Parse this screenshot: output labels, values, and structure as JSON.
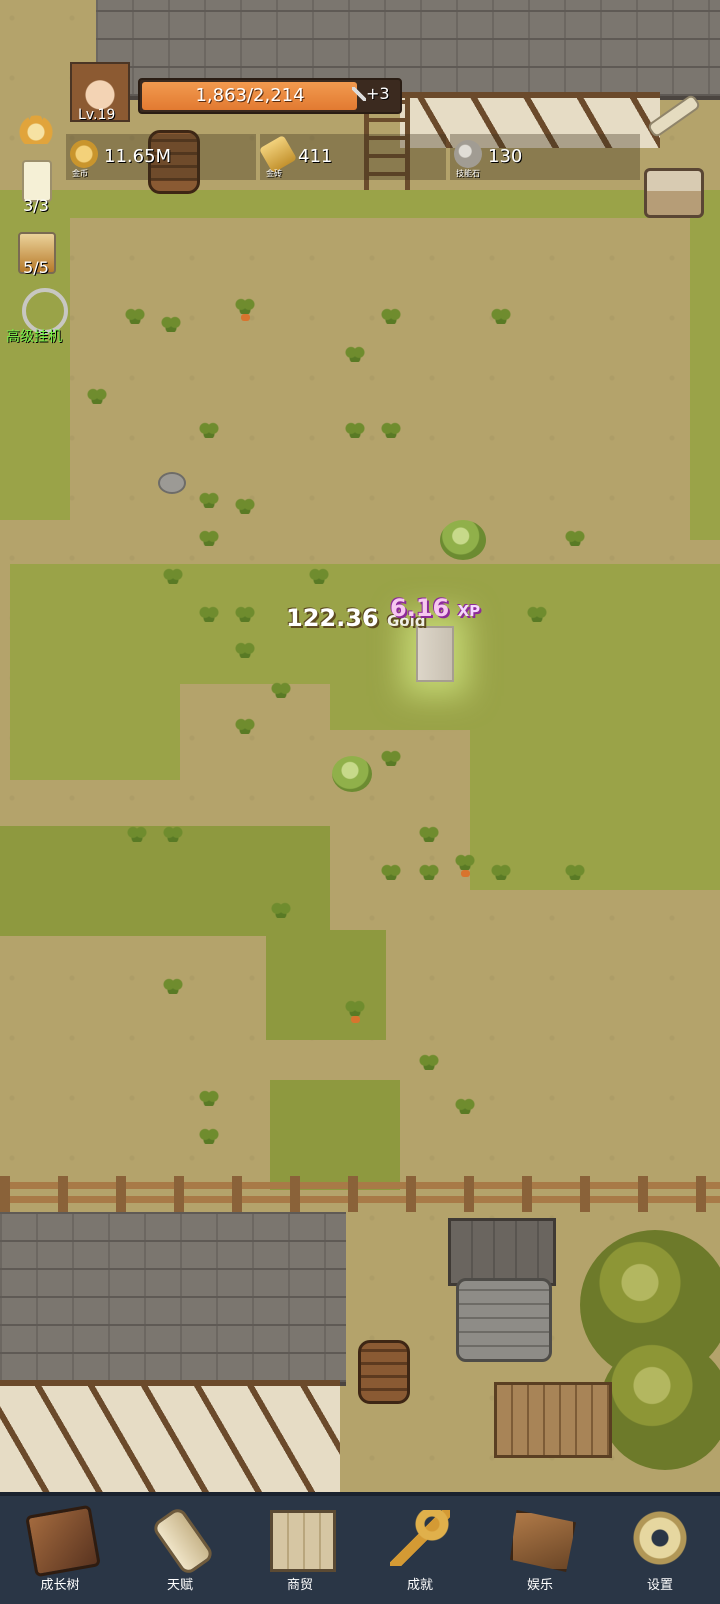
{
  "hud": {
    "level": "Lv.19",
    "xp_text": "1,863/2,214",
    "xp_fraction": 0.841,
    "xp_bonus": "+3",
    "resources": [
      {
        "name": "coin-icon",
        "value": "11.65M",
        "label": "金币"
      },
      {
        "name": "gold-bar-icon",
        "value": "411",
        "label": "金砖"
      },
      {
        "name": "skill-stone-icon",
        "value": "130",
        "label": "技能石"
      }
    ],
    "side": {
      "candle_count": "3/3",
      "drink_count": "5/5",
      "afk_label": "高级挂机"
    }
  },
  "floating": {
    "gold_value": "122.36",
    "gold_unit": "Gold",
    "xp_value": "6.16",
    "xp_unit": "XP"
  },
  "nav": {
    "items": [
      {
        "label": "成长树",
        "icon": "book-icon"
      },
      {
        "label": "天赋",
        "icon": "scroll-icon"
      },
      {
        "label": "商贸",
        "icon": "map-icon"
      },
      {
        "label": "成就",
        "icon": "key-icon"
      },
      {
        "label": "娱乐",
        "icon": "banner-icon"
      },
      {
        "label": "设置",
        "icon": "gear-icon"
      }
    ]
  }
}
